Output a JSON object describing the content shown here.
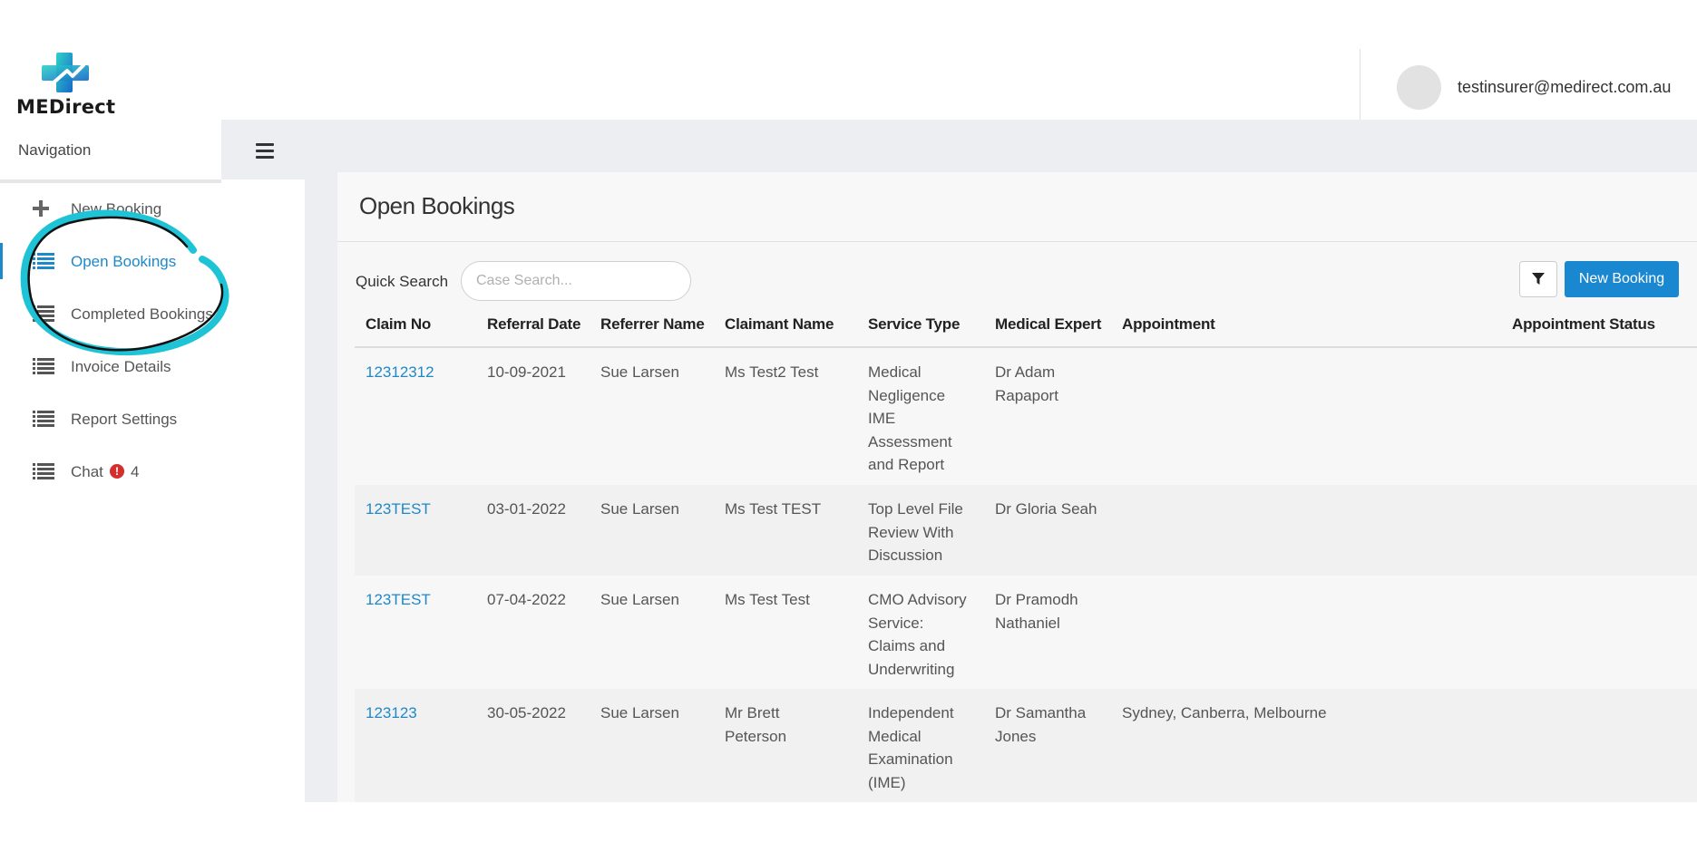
{
  "app": {
    "brand": "MEDirect",
    "user_email": "testinsurer@medirect.com.au"
  },
  "sidebar": {
    "title": "Navigation",
    "items": [
      {
        "label": "New Booking",
        "icon": "plus-icon"
      },
      {
        "label": "Open Bookings",
        "icon": "list-icon",
        "active": true
      },
      {
        "label": "Completed Bookings",
        "icon": "list-icon"
      },
      {
        "label": "Invoice Details",
        "icon": "list-icon"
      },
      {
        "label": "Report Settings",
        "icon": "list-icon"
      },
      {
        "label": "Chat",
        "icon": "list-icon",
        "badge": "!",
        "count": "4"
      }
    ]
  },
  "main": {
    "title": "Open Bookings",
    "quick_search_label": "Quick Search",
    "search_placeholder": "Case Search...",
    "new_booking_label": "New Booking",
    "columns": [
      "Claim No",
      "Referral Date",
      "Referrer Name",
      "Claimant Name",
      "Service Type",
      "Medical Expert",
      "Appointment",
      "Appointment Status"
    ],
    "rows": [
      {
        "claim_no": "12312312",
        "referral_date": "10-09-2021",
        "referrer": "Sue Larsen",
        "claimant": "Ms Test2 Test",
        "service": "Medical Negligence IME Assessment and Report",
        "expert": "Dr Adam Rapaport",
        "appointment": "",
        "status": ""
      },
      {
        "claim_no": "123TEST",
        "referral_date": "03-01-2022",
        "referrer": "Sue Larsen",
        "claimant": "Ms Test TEST",
        "service": "Top Level File Review With Discussion",
        "expert": "Dr Gloria Seah",
        "appointment": "",
        "status": ""
      },
      {
        "claim_no": "123TEST",
        "referral_date": "07-04-2022",
        "referrer": "Sue Larsen",
        "claimant": "Ms Test Test",
        "service": "CMO Advisory Service: Claims and Underwriting",
        "expert": "Dr Pramodh Nathaniel",
        "appointment": "",
        "status": ""
      },
      {
        "claim_no": "123123",
        "referral_date": "30-05-2022",
        "referrer": "Sue Larsen",
        "claimant": "Mr Brett Peterson",
        "service": "Independent Medical Examination (IME)",
        "expert": "Dr Samantha Jones",
        "appointment": "Sydney, Canberra, Melbourne",
        "status": ""
      }
    ]
  },
  "colors": {
    "accent": "#1e88c8",
    "button": "#1a88d1",
    "annotation": "#1fc3d6",
    "alert": "#d32f2f"
  }
}
